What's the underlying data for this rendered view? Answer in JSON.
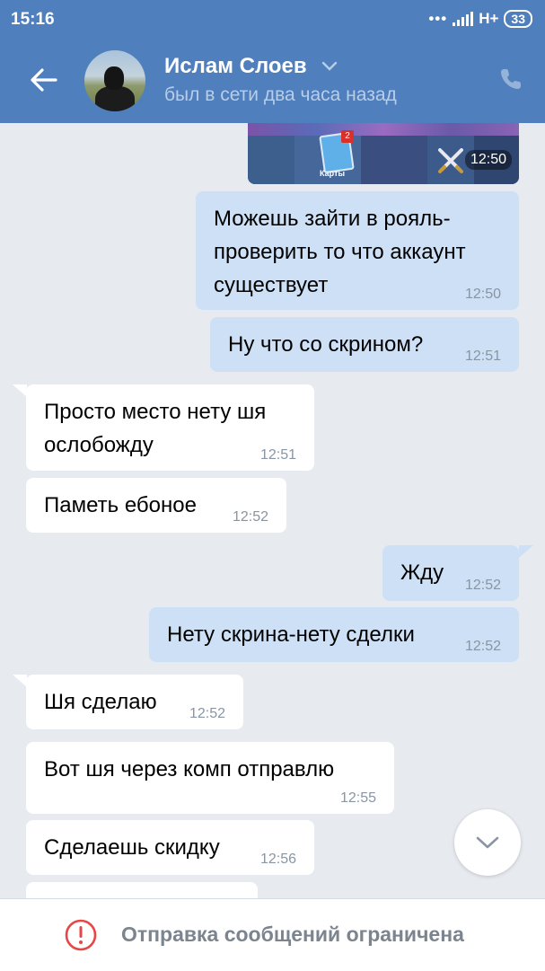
{
  "status_bar": {
    "time": "15:16",
    "network": "H+",
    "battery": "33"
  },
  "header": {
    "contact_name": "Ислам Слоев",
    "contact_status": "был в сети два часа назад"
  },
  "image_message": {
    "card_label": "Карты",
    "badge_count": "2",
    "time": "12:50"
  },
  "messages": [
    {
      "dir": "out",
      "lines": [
        "Можешь зайти в рояль-",
        "проверить то что аккаунт",
        "существует"
      ],
      "time": "12:50"
    },
    {
      "dir": "out",
      "lines": [
        "Ну что со скрином?"
      ],
      "time": "12:51"
    },
    {
      "dir": "in",
      "lines": [
        "Просто место нету шя",
        "ослобожду"
      ],
      "time": "12:51"
    },
    {
      "dir": "in",
      "lines": [
        "Паметь ебоное"
      ],
      "time": "12:52"
    },
    {
      "dir": "out",
      "lines": [
        "Жду"
      ],
      "time": "12:52"
    },
    {
      "dir": "out",
      "lines": [
        "Нету скрина-нету сделки"
      ],
      "time": "12:52"
    },
    {
      "dir": "in",
      "lines": [
        "Шя сделаю"
      ],
      "time": "12:52"
    },
    {
      "dir": "in",
      "lines": [
        "Вот шя через комп отправлю"
      ],
      "time": "12:55"
    },
    {
      "dir": "in",
      "lines": [
        "Сделаешь скидку"
      ],
      "time": "12:56"
    }
  ],
  "footer": {
    "notice": "Отправка сообщений ограничена"
  },
  "colors": {
    "header": "#4f7fbd",
    "outgoing": "#cde0f6",
    "incoming": "#ffffff",
    "chat_bg": "#e7ebf0",
    "warning": "#e64646"
  }
}
